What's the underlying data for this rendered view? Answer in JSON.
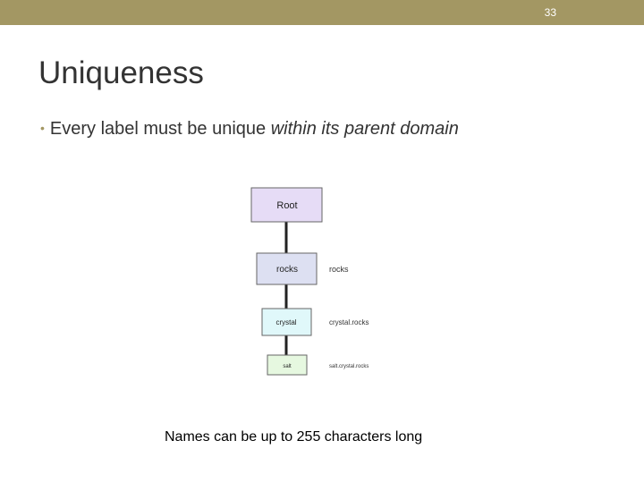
{
  "slide": {
    "number": "33",
    "title": "Uniqueness",
    "bullet": {
      "text_before": "Every label must be unique ",
      "text_italic": "within its parent domain"
    },
    "caption": "Names can be up to 255 characters long"
  },
  "diagram": {
    "nodes": [
      {
        "label": "Root",
        "full_name": ""
      },
      {
        "label": "rocks",
        "full_name": "rocks"
      },
      {
        "label": "crystal",
        "full_name": "crystal.rocks"
      },
      {
        "label": "salt",
        "full_name": "salt.crystal.rocks"
      }
    ],
    "colors": {
      "root": "#e6dcf6",
      "rocks": "#dde0f2",
      "crystal": "#e0f8fa",
      "salt": "#e6f8e0",
      "line": "#222222",
      "accent": "#a39763"
    }
  }
}
